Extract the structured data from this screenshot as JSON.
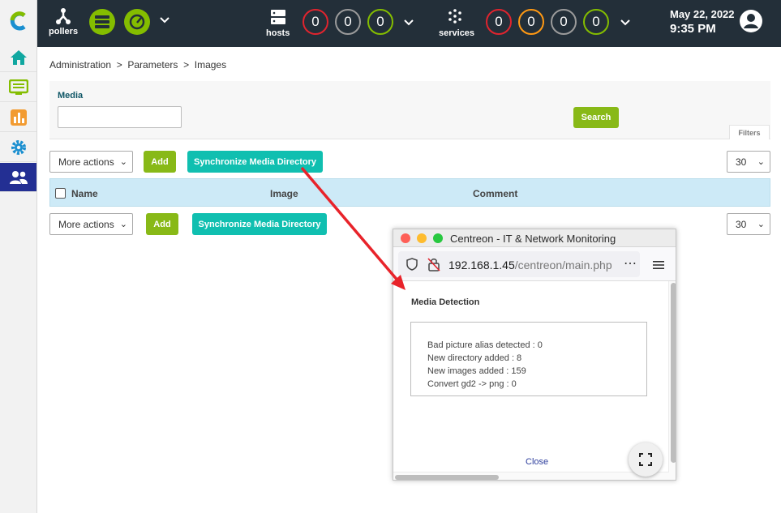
{
  "topbar": {
    "pollers_label": "pollers",
    "hosts_label": "hosts",
    "services_label": "services",
    "host_counts": [
      "0",
      "0",
      "0"
    ],
    "service_counts": [
      "0",
      "0",
      "0",
      "0"
    ],
    "date": "May 22, 2022",
    "time": "9:35 PM"
  },
  "breadcrumb": "Administration  >  Parameters  >  Images",
  "filter": {
    "media_label": "Media",
    "media_value": "",
    "search_label": "Search",
    "filters_tab": "Filters"
  },
  "toolbar": {
    "more_actions": "More actions",
    "add_label": "Add",
    "sync_label": "Synchronize Media Directory",
    "page_size": "30"
  },
  "table": {
    "columns": [
      "Name",
      "Image",
      "Comment"
    ]
  },
  "popup": {
    "window_title": "Centreon - IT & Network Monitoring",
    "url_host": "192.168.1.45",
    "url_path": "/centreon/main.php",
    "heading": "Media Detection",
    "lines": [
      "Bad picture alias detected : 0",
      "New directory added : 8",
      "New images added : 159",
      "Convert gd2 -> png : 0"
    ],
    "close_label": "Close"
  },
  "colors": {
    "topbar": "#232f39",
    "accent_green": "#84bd00",
    "accent_teal": "#10bfb0",
    "status_red": "#e0242e",
    "status_orange": "#ff9913",
    "sidebar_active": "#232f93",
    "arrow": "#e8232a"
  }
}
